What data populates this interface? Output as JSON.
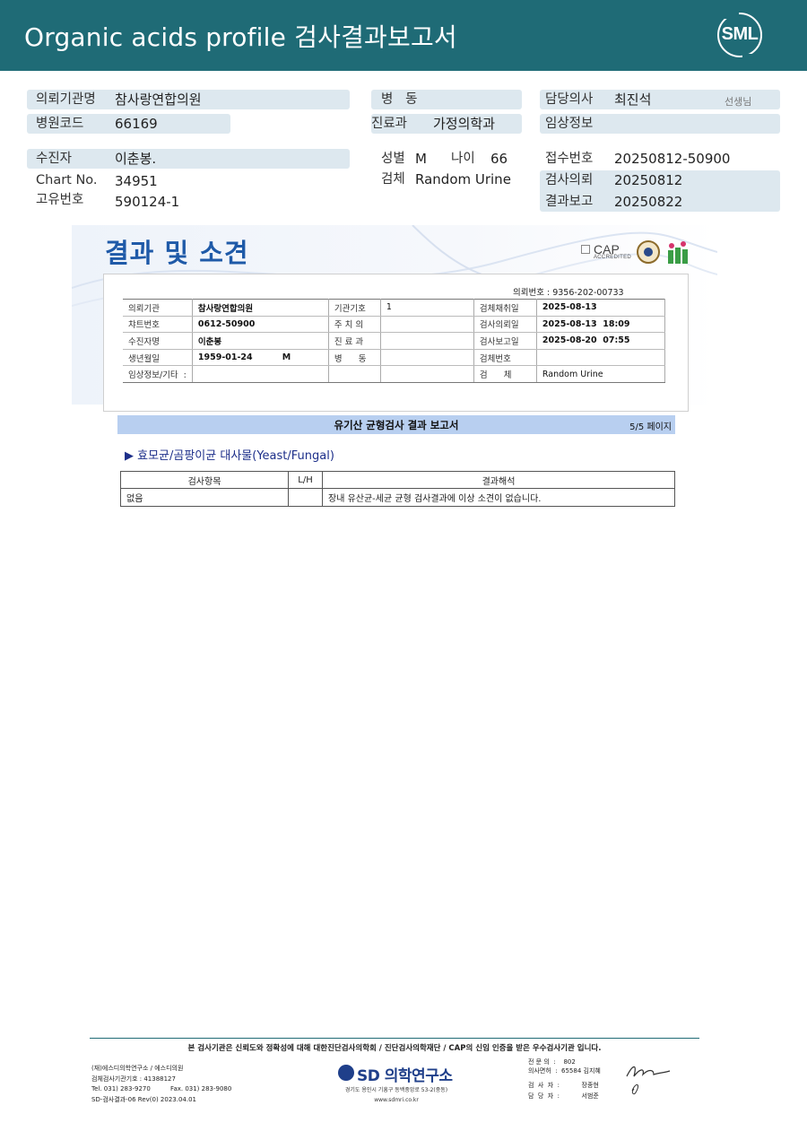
{
  "header": {
    "title": "Organic acids profile 검사결과보고서",
    "logo_text": "SML"
  },
  "info": {
    "institution_label": "의뢰기관명",
    "institution": "참사랑연합의원",
    "code_label": "병원코드",
    "code": "66169",
    "ward_label": "병   동",
    "ward": "",
    "dept_label": "진료과",
    "dept": "가정의학과",
    "doctor_label": "담당의사",
    "doctor": "최진석",
    "doctor_suffix": "선생님",
    "clinical_label": "임상정보",
    "clinical": "",
    "patient_label": "수진자",
    "patient": "이춘봉.",
    "chart_label": "Chart No.",
    "chart": "34951",
    "id_label": "고유번호",
    "id": "590124-1",
    "sex_label": "성별",
    "sex": "M",
    "age_label": "나이",
    "age": "66",
    "specimen_label": "검체",
    "specimen": "Random Urine",
    "receipt_label": "접수번호",
    "receipt": "20250812-50900",
    "request_label": "검사의뢰",
    "request": "20250812",
    "report_label": "결과보고",
    "report": "20250822"
  },
  "report": {
    "title": "결과 및 소견",
    "cap_main": "CAP",
    "cap_sub": "ACCREDITED",
    "request_no": "의뢰번호 :  9356-202-00733",
    "table": [
      [
        "의뢰기관",
        "참사랑연합의원",
        "기관기호",
        "1",
        "검체채취일",
        "2025-08-13"
      ],
      [
        "챠트번호",
        "0612-50900",
        "주 치 의",
        "",
        "검사의뢰일",
        "2025-08-13  18:09"
      ],
      [
        "수진자명",
        "이춘봉",
        "진 료 과",
        "",
        "검사보고일",
        "2025-08-20  07:55"
      ],
      [
        "생년월일",
        "1959-01-24          M",
        "병      동",
        "",
        "검체번호",
        ""
      ],
      [
        "임상정보/기타  :",
        "",
        "",
        "",
        "검      체",
        "Random Urine"
      ]
    ],
    "section_title": "유기산 균형검사 결과 보고서",
    "section_page": "5/5 페이지",
    "subsection": "▶  효모균/곰팡이균 대사물(Yeast/Fungal)",
    "result_headers": [
      "검사항목",
      "L/H",
      "결과해석"
    ],
    "result_rows": [
      [
        "없음",
        "",
        "장내 유산균-세균 균형 검사결과에 이상 소견이 없습니다."
      ]
    ]
  },
  "footer": {
    "cert_text": "본 검사기관은 신뢰도와 정확성에 대해 대한진단검사의학회 / 진단검사의학재단 / CAP의 신임 인증을 받은 우수검사기관 입니다.",
    "org": "(재)에스디의학연구소 / 에스디의원",
    "org_code": "검체검사기관기호 : 41388127",
    "tel": "Tel. 031) 283-9270          Fax. 031) 283-9080",
    "form": "SD-검사결과-06 Rev(0) 2023.04.01",
    "sd_name": "SD 의학연구소",
    "address": "경기도 용인시 기흥구 동백중앙로 53-2(중동)",
    "website": "www.sdmri.co.kr",
    "director": "전 문 의  :    802",
    "license": "의사면허  :  65584 김지혜",
    "tester": "검  사  자  :           장종현",
    "manager": "담  당  자  :           서범준"
  }
}
